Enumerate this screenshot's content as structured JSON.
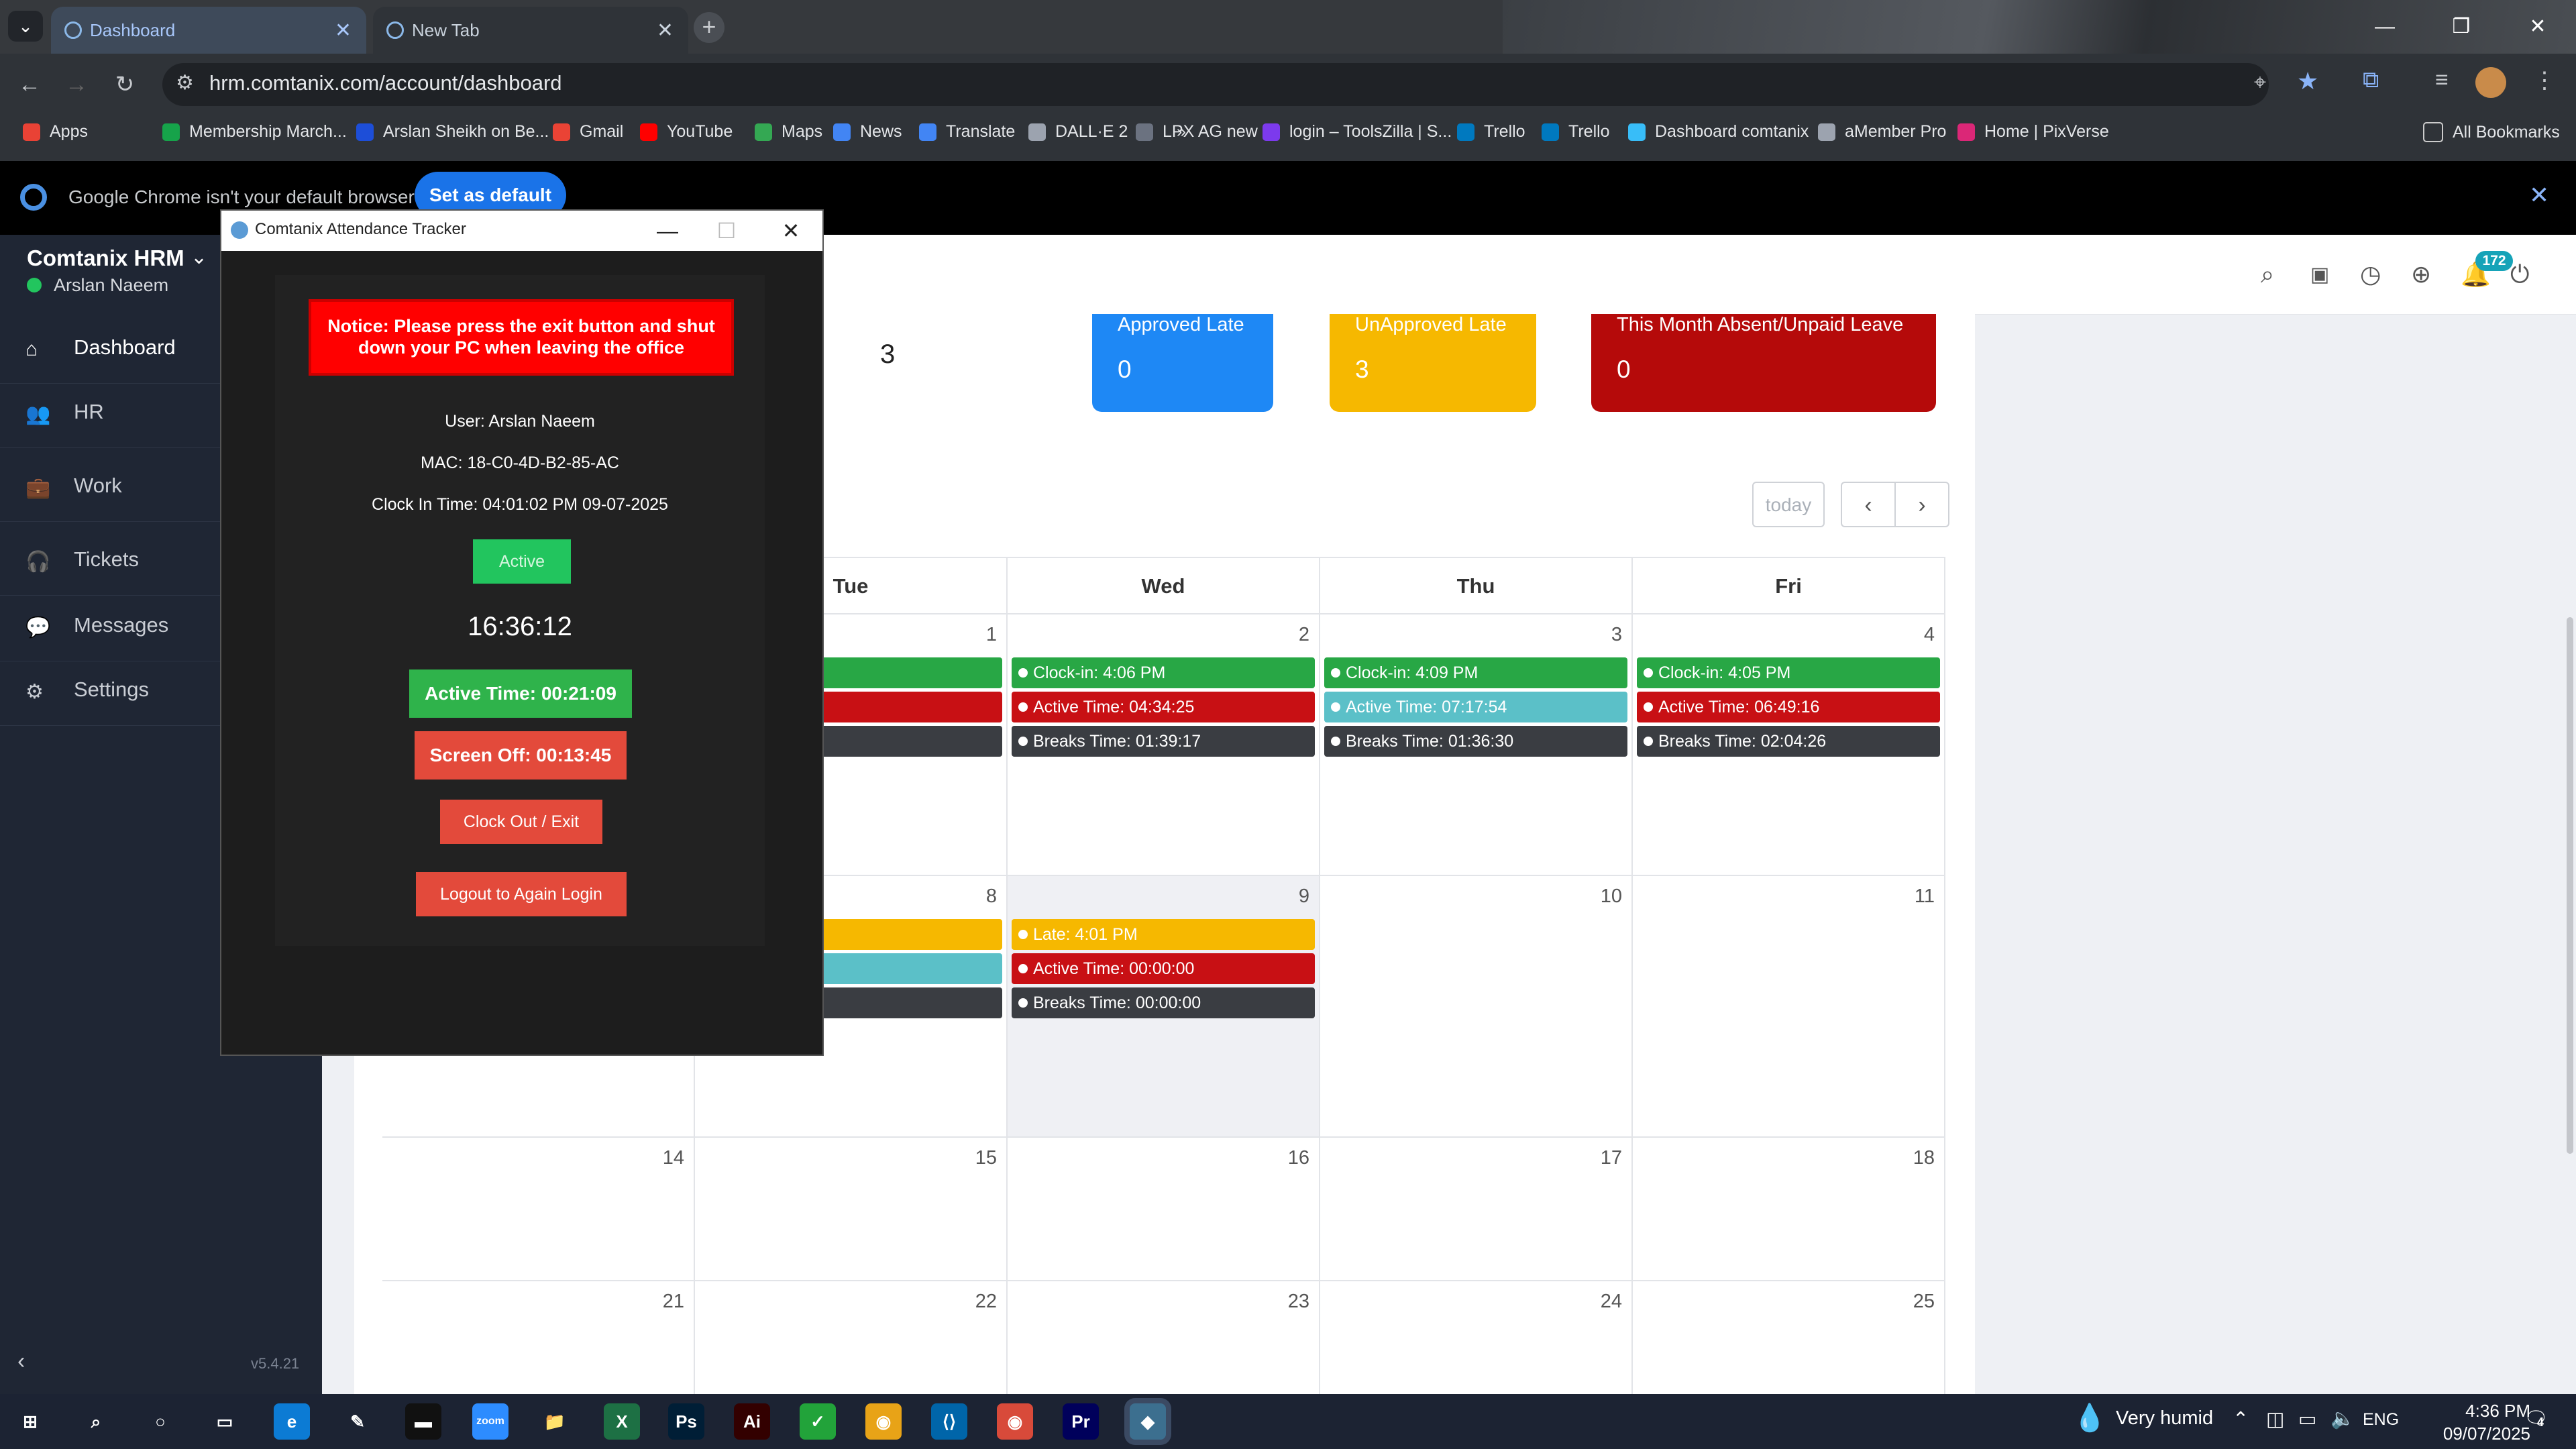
{
  "browser": {
    "tabs": [
      {
        "label": "Dashboard",
        "active": true
      },
      {
        "label": "New Tab",
        "active": false
      }
    ],
    "new_tab_glyph": "+",
    "url": "hrm.comtanix.com/account/dashboard",
    "bookmarks": [
      {
        "label": "Apps",
        "color": "#e94235"
      },
      {
        "label": "Membership March...",
        "color": "#16a34a"
      },
      {
        "label": "Arslan Sheikh on Be...",
        "color": "#1d4ed8"
      },
      {
        "label": "Gmail",
        "color": "#ea4335"
      },
      {
        "label": "YouTube",
        "color": "#ff0000"
      },
      {
        "label": "Maps",
        "color": "#34a853"
      },
      {
        "label": "News",
        "color": "#4285f4"
      },
      {
        "label": "Translate",
        "color": "#4285f4"
      },
      {
        "label": "DALL·E 2",
        "color": "#9ca3af"
      },
      {
        "label": "LPX AG new",
        "color": "#6b7280"
      },
      {
        "label": "login – ToolsZilla | S...",
        "color": "#7c3aed"
      },
      {
        "label": "Trello",
        "color": "#0079bf"
      },
      {
        "label": "Trello",
        "color": "#0079bf"
      },
      {
        "label": "Dashboard comtanix",
        "color": "#38bdf8"
      },
      {
        "label": "aMember Pro",
        "color": "#9ca3af"
      },
      {
        "label": "Home | PixVerse",
        "color": "#db2777"
      }
    ],
    "all_bookmarks": "All Bookmarks",
    "default_notice": "Google Chrome isn't your default browser",
    "set_default": "Set as default"
  },
  "sidebar": {
    "brand": "Comtanix HRM",
    "user": "Arslan Naeem",
    "items": [
      {
        "label": "Dashboard",
        "icon": "home-icon",
        "glyph": "⌂"
      },
      {
        "label": "HR",
        "icon": "users-icon",
        "glyph": "👥"
      },
      {
        "label": "Work",
        "icon": "briefcase-icon",
        "glyph": "💼"
      },
      {
        "label": "Tickets",
        "icon": "headset-icon",
        "glyph": "🎧"
      },
      {
        "label": "Messages",
        "icon": "message-icon",
        "glyph": "💬"
      },
      {
        "label": "Settings",
        "icon": "gear-icon",
        "glyph": "⚙"
      }
    ],
    "version": "v5.4.21"
  },
  "header": {
    "notification_count": "172"
  },
  "stats": [
    {
      "value": "3"
    },
    {
      "title": "Approved Late",
      "value": "0",
      "color": "#1e88f5"
    },
    {
      "title": "UnApproved Late",
      "value": "3",
      "color": "#f6b800"
    },
    {
      "title": "This Month Absent/Unpaid Leave",
      "value": "0",
      "color": "#b50a0a"
    }
  ],
  "calendar": {
    "today_label": "today",
    "prev": "‹",
    "next": "›",
    "days": [
      "Tue",
      "Wed",
      "Thu",
      "Fri"
    ],
    "weeks": [
      {
        "cells": [
          {
            "num": "1",
            "events": [
              {
                "text": "PM",
                "type": "green"
              },
              {
                "text": "00:00:00",
                "type": "red"
              },
              {
                "text": "00:00:00",
                "type": "dark"
              }
            ]
          },
          {
            "num": "2",
            "events": [
              {
                "text": "Clock-in: 4:06 PM",
                "type": "green"
              },
              {
                "text": "Active Time: 04:34:25",
                "type": "red"
              },
              {
                "text": "Breaks Time: 01:39:17",
                "type": "dark"
              }
            ]
          },
          {
            "num": "3",
            "events": [
              {
                "text": "Clock-in: 4:09 PM",
                "type": "green"
              },
              {
                "text": "Active Time: 07:17:54",
                "type": "teal"
              },
              {
                "text": "Breaks Time: 01:36:30",
                "type": "dark"
              }
            ]
          },
          {
            "num": "4",
            "events": [
              {
                "text": "Clock-in: 4:05 PM",
                "type": "green"
              },
              {
                "text": "Active Time: 06:49:16",
                "type": "red"
              },
              {
                "text": "Breaks Time: 02:04:26",
                "type": "dark"
              }
            ]
          }
        ]
      },
      {
        "cells": [
          {
            "num": "8",
            "events": [
              {
                "text": "",
                "type": "yellow"
              },
              {
                "text": "7:24:03",
                "type": "teal"
              },
              {
                "text": "01:31:14",
                "type": "dark"
              }
            ]
          },
          {
            "num": "9",
            "events": [
              {
                "text": "Late: 4:01 PM",
                "type": "yellow"
              },
              {
                "text": "Active Time: 00:00:00",
                "type": "red"
              },
              {
                "text": "Breaks Time: 00:00:00",
                "type": "dark"
              }
            ]
          },
          {
            "num": "10",
            "events": []
          },
          {
            "num": "11",
            "events": []
          }
        ]
      }
    ],
    "week3": [
      "14",
      "15",
      "16",
      "17",
      "18"
    ],
    "week4": [
      "21",
      "22",
      "23",
      "24",
      "25"
    ]
  },
  "tracker": {
    "title": "Comtanix Attendance Tracker",
    "notice": "Notice: Please press the exit button and shut down your PC when leaving the office",
    "user": "User: Arslan  Naeem",
    "mac": "MAC: 18-C0-4D-B2-85-AC",
    "clock_in": "Clock In Time: 04:01:02 PM 09-07-2025",
    "status": "Active",
    "clock": "16:36:12",
    "active_time": "Active Time: 00:21:09",
    "screen_off": "Screen Off: 00:13:45",
    "clock_out": "Clock Out / Exit",
    "logout": "Logout to Again Login"
  },
  "taskbar": {
    "weather": "Very humid",
    "lang": "ENG",
    "time": "4:36 PM",
    "date": "09/07/2025",
    "notifications": "4",
    "apps": [
      {
        "name": "start",
        "glyph": "⊞",
        "color": "transparent"
      },
      {
        "name": "search",
        "glyph": "⌕",
        "color": "transparent"
      },
      {
        "name": "cortana",
        "glyph": "○",
        "color": "transparent"
      },
      {
        "name": "task-view",
        "glyph": "▭",
        "color": "transparent"
      },
      {
        "name": "edge",
        "glyph": "e",
        "color": "#0c7bd4"
      },
      {
        "name": "pen",
        "glyph": "✎",
        "color": "transparent"
      },
      {
        "name": "terminal",
        "glyph": "▬",
        "color": "#111"
      },
      {
        "name": "zoom",
        "glyph": "zoom",
        "color": "#2d8cff"
      },
      {
        "name": "explorer",
        "glyph": "📁",
        "color": "transparent"
      },
      {
        "name": "excel",
        "glyph": "X",
        "color": "#1d7044"
      },
      {
        "name": "photoshop",
        "glyph": "Ps",
        "color": "#001e36"
      },
      {
        "name": "illustrator",
        "glyph": "Ai",
        "color": "#330000"
      },
      {
        "name": "green-app",
        "glyph": "✓",
        "color": "#22a33a"
      },
      {
        "name": "chrome",
        "glyph": "◉",
        "color": "#e8a317"
      },
      {
        "name": "vscode",
        "glyph": "⟨⟩",
        "color": "#0065a9"
      },
      {
        "name": "chrome-2",
        "glyph": "◉",
        "color": "#d84a3a"
      },
      {
        "name": "premiere",
        "glyph": "Pr",
        "color": "#00005b"
      },
      {
        "name": "comtanix",
        "glyph": "◆",
        "color": "#3c6f8f"
      }
    ]
  }
}
